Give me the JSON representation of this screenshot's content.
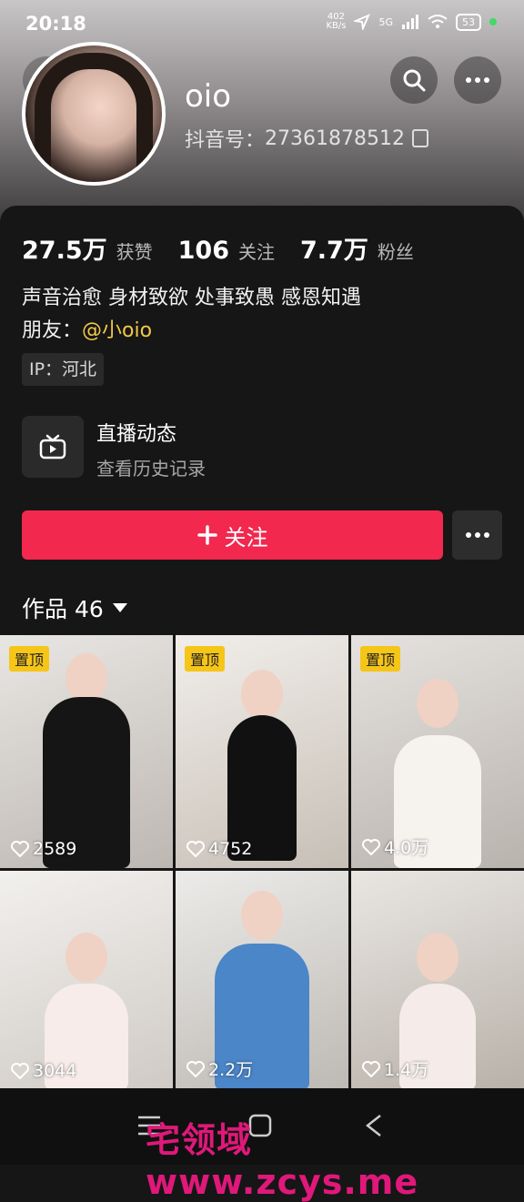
{
  "status_bar": {
    "time": "20:18",
    "net_speed_top": "402",
    "net_speed_unit": "KB/s",
    "signal": "5G",
    "battery": "53"
  },
  "profile": {
    "name": "oio",
    "id_label": "抖音号：",
    "id_value": "27361878512"
  },
  "stats": [
    {
      "value": "27.5万",
      "label": "获赞"
    },
    {
      "value": "106",
      "label": "关注"
    },
    {
      "value": "7.7万",
      "label": "粉丝"
    }
  ],
  "bio": {
    "line1": "声音治愈 身材致欲 处事致愚 感恩知遇",
    "friend_label": "朋友：",
    "friend_mention": "@小oio"
  },
  "ip": "IP：河北",
  "live": {
    "title": "直播动态",
    "subtitle": "查看历史记录"
  },
  "actions": {
    "follow_label": "关注"
  },
  "works": {
    "label": "作品 46"
  },
  "posts": [
    {
      "pinned": "置顶",
      "likes": "2589"
    },
    {
      "pinned": "置顶",
      "likes": "4752"
    },
    {
      "pinned": "置顶",
      "likes": "4.0万"
    },
    {
      "pinned": "",
      "likes": "3044"
    },
    {
      "pinned": "",
      "likes": "2.2万"
    },
    {
      "pinned": "",
      "likes": "1.4万"
    }
  ],
  "watermark": "宅领域 www.zcys.me",
  "colors": {
    "accent": "#f2284f",
    "mention": "#f0c94b",
    "pin": "#f5c518"
  }
}
